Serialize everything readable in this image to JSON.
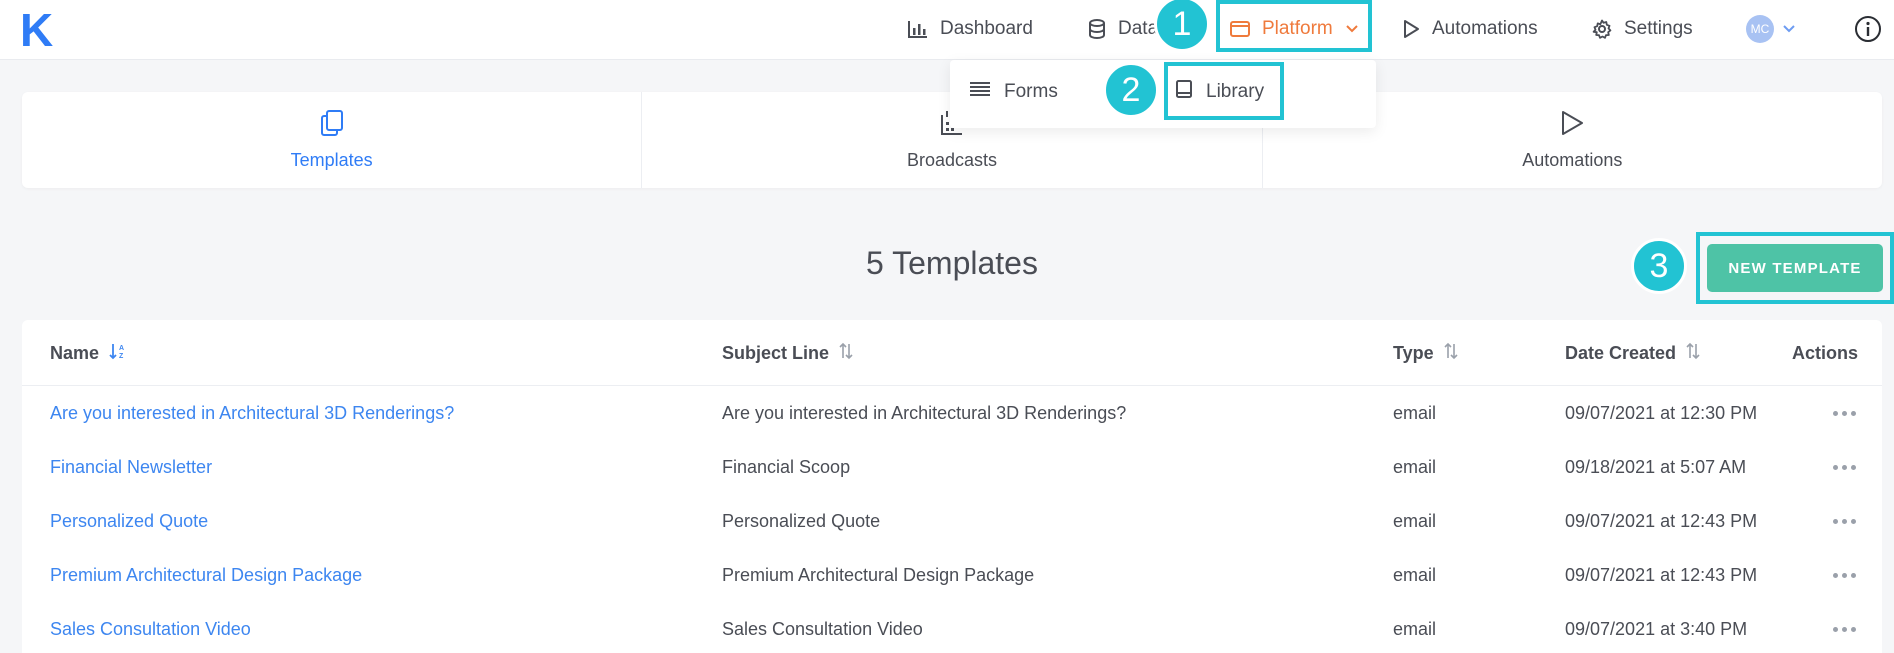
{
  "logo": "K",
  "nav": {
    "dashboard": "Dashboard",
    "data": "Data",
    "platform": "Platform",
    "automations": "Automations",
    "settings": "Settings",
    "avatar_initials": "MC"
  },
  "dropdown": {
    "forms": "Forms",
    "library": "Library"
  },
  "subnav": {
    "templates": "Templates",
    "broadcasts": "Broadcasts",
    "automations": "Automations"
  },
  "heading": "5 Templates",
  "new_template_label": "NEW TEMPLATE",
  "table": {
    "headers": {
      "name": "Name",
      "subject": "Subject Line",
      "type": "Type",
      "date": "Date Created",
      "actions": "Actions"
    },
    "rows": [
      {
        "name": "Are you interested in Architectural 3D Renderings?",
        "subject": "Are you interested in Architectural 3D Renderings?",
        "type": "email",
        "date": "09/07/2021 at 12:30 PM"
      },
      {
        "name": "Financial Newsletter",
        "subject": "Financial Scoop",
        "type": "email",
        "date": "09/18/2021 at 5:07 AM"
      },
      {
        "name": "Personalized Quote",
        "subject": "Personalized Quote",
        "type": "email",
        "date": "09/07/2021 at 12:43 PM"
      },
      {
        "name": "Premium Architectural Design Package",
        "subject": "Premium Architectural Design Package",
        "type": "email",
        "date": "09/07/2021 at 12:43 PM"
      },
      {
        "name": "Sales Consultation Video",
        "subject": "Sales Consultation Video",
        "type": "email",
        "date": "09/07/2021 at 3:40 PM"
      }
    ]
  },
  "annotations": {
    "step1": "1",
    "step2": "2",
    "step3": "3",
    "highlight_color": "#22c3d3"
  },
  "colors": {
    "brand_blue": "#2f7cf6",
    "platform_orange": "#ef7a3c",
    "button_green": "#4ec3a6"
  }
}
